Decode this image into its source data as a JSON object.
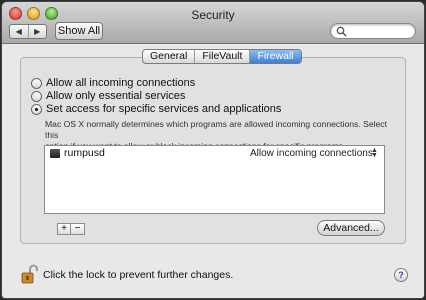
{
  "window": {
    "title": "Security"
  },
  "toolbar": {
    "back_glyph": "◀",
    "forward_glyph": "▶",
    "show_all_label": "Show All",
    "search": {
      "placeholder": "",
      "icon": "magnifier-icon"
    }
  },
  "tabs": [
    {
      "label": "General",
      "active": false
    },
    {
      "label": "FileVault",
      "active": false
    },
    {
      "label": "Firewall",
      "active": true
    }
  ],
  "firewall": {
    "options": [
      {
        "label": "Allow all incoming connections",
        "selected": false
      },
      {
        "label": "Allow only essential services",
        "selected": false
      },
      {
        "label": "Set access for specific services and applications",
        "selected": true
      }
    ],
    "description_line1": "Mac OS X normally determines which programs are allowed incoming connections. Select this",
    "description_line2": "option if you want to allow or block incoming connections for specific programs.",
    "apps": [
      {
        "name": "rumpusd",
        "status": "Allow incoming connections"
      }
    ],
    "add_label": "+",
    "remove_label": "−",
    "advanced_label": "Advanced..."
  },
  "footer": {
    "lock_text": "Click the lock to prevent further changes.",
    "help_label": "?"
  },
  "colors": {
    "accent": "#3d7ed6",
    "window_bg": "#e8e8e8"
  }
}
